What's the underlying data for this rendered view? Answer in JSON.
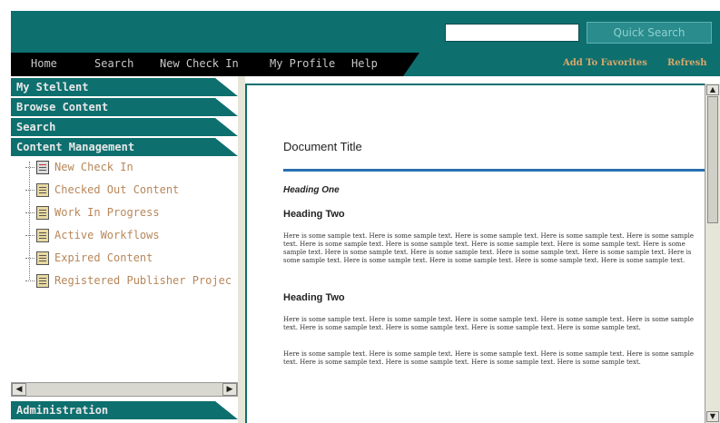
{
  "header": {
    "search_input_value": "",
    "quick_search_label": "Quick Search"
  },
  "nav": {
    "left": [
      "Home",
      "Search",
      "New Check In",
      "My Profile",
      "Help"
    ],
    "right": [
      "Add To Favorites",
      "Refresh"
    ]
  },
  "sidebar": {
    "sections": [
      "My Stellent",
      "Browse Content",
      "Search",
      "Content Management"
    ],
    "tree": [
      {
        "label": "New Check In",
        "icon": "check-in-icon"
      },
      {
        "label": "Checked Out Content",
        "icon": "document-icon"
      },
      {
        "label": "Work In Progress",
        "icon": "document-icon"
      },
      {
        "label": "Active Workflows",
        "icon": "document-icon"
      },
      {
        "label": "Expired Content",
        "icon": "document-icon"
      },
      {
        "label": "Registered Publisher Projec",
        "icon": "document-icon"
      }
    ],
    "bottom_section": "Administration"
  },
  "content": {
    "title": "Document Title",
    "heading_one": "Heading One",
    "heading_two_a": "Heading Two",
    "heading_two_b": "Heading Two",
    "para1": "Here is some sample text. Here is some sample text. Here is some sample text. Here is some sample text. Here is some sample text. Here is some sample text. Here is some sample text. Here is some sample text. Here is some sample text. Here is some sample text. Here is some sample text. Here is some sample text. Here is some sample text. Here is some sample text. Here is some sample text. Here is some sample text. Here is some sample text. Here is some sample text. Here is some sample text.",
    "para2": "Here is some sample text. Here is some sample text. Here is some sample text. Here is some sample text. Here is some sample text. Here is some sample text. Here is some sample text. Here is some sample text. Here is some sample text.",
    "para3": "Here is some sample text. Here is some sample text. Here is some sample text. Here is some sample text. Here is some sample text. Here is some sample text. Here is some sample text. Here is some sample text. Here is some sample text."
  },
  "colors": {
    "teal": "#0e6f6f",
    "rule_blue": "#2a6fb0",
    "tree_text": "#b8875a"
  }
}
